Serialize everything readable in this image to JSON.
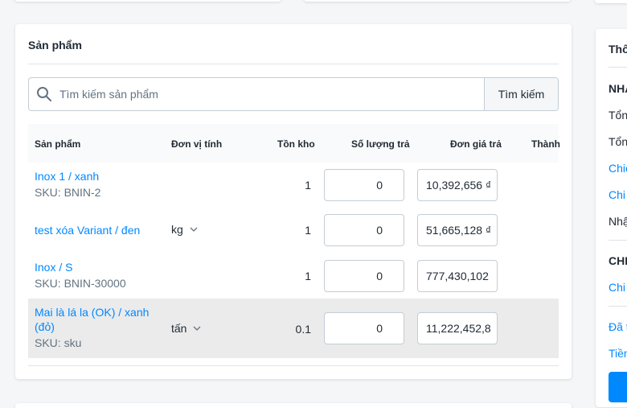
{
  "products": {
    "title": "Sản phẩm",
    "search": {
      "placeholder": "Tìm kiếm sản phẩm",
      "button_label": "Tìm kiếm"
    },
    "columns": {
      "product": "Sản phẩm",
      "unit": "Đơn vị tính",
      "stock": "Tồn kho",
      "return_qty": "Số lượng trả",
      "return_price": "Đơn giá trả",
      "total": "Thành"
    },
    "rows": [
      {
        "name": "Inox 1 / xanh",
        "sku": "SKU: BNIN-2",
        "unit": "",
        "stock": "1",
        "qty": "0",
        "price": "10,392,656 ₫"
      },
      {
        "name": "test xóa Variant / đen",
        "sku": "",
        "unit": "kg",
        "stock": "1",
        "qty": "0",
        "price": "51,665,128 ₫"
      },
      {
        "name": "Inox / S",
        "sku": "SKU: BNIN-30000",
        "unit": "",
        "stock": "1",
        "qty": "0",
        "price": "777,430,102"
      },
      {
        "name": "Mai là lá la (OK) / xanh (đỏ)",
        "sku": "SKU: sku",
        "unit": "tấn",
        "stock": "0.1",
        "qty": "0",
        "price": "11,222,452,8"
      }
    ]
  },
  "side": {
    "title": "Thô",
    "section1": "NHẢ",
    "line1": "Tổn",
    "line2": "Tổn",
    "link1": "Chiế",
    "link2": "Chi",
    "line3": "Nhậ",
    "section2": "CHI",
    "link3": "Chi",
    "link4": "Đã t",
    "link5": "Tiền"
  },
  "colors": {
    "link": "#0088ff",
    "highlight_row": "#ebebeb",
    "primary_button": "#0088ff"
  }
}
